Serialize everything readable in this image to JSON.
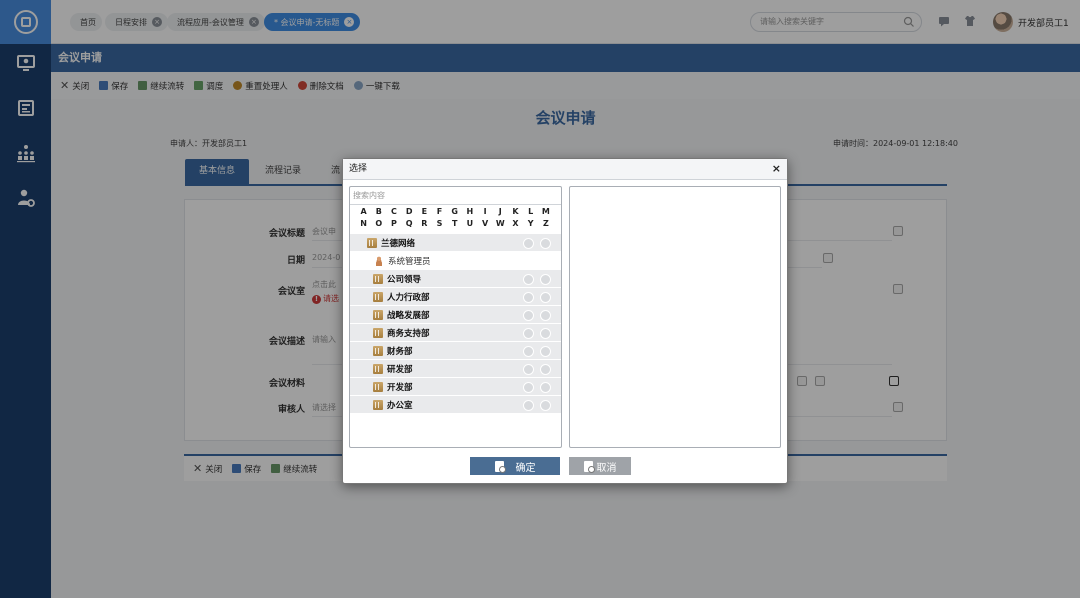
{
  "header": {
    "tabs": [
      {
        "label": "首页",
        "closable": false
      },
      {
        "label": "日程安排",
        "closable": true
      },
      {
        "label": "流程应用-会议管理",
        "closable": true
      },
      {
        "label": "* 会议申请-无标题",
        "closable": true,
        "active": true
      }
    ],
    "search_placeholder": "请输入搜索关键字",
    "username": "开发部员工1"
  },
  "sidebar": {
    "items": [
      {
        "icon": "app-logo-icon"
      },
      {
        "icon": "monitor-user-icon"
      },
      {
        "icon": "news-icon"
      },
      {
        "icon": "org-chart-icon"
      },
      {
        "icon": "user-settings-icon"
      }
    ]
  },
  "page": {
    "title": "会议申请",
    "toolbar": [
      "关闭",
      "保存",
      "继续流转",
      "调度",
      "重置处理人",
      "删除文档",
      "一键下载"
    ]
  },
  "form": {
    "title": "会议申请",
    "applicant": "申请人：开发部员工1",
    "apply_time": "申请时间：2024-09-01 12:18:40",
    "tabs": [
      "基本信息",
      "流程记录",
      "流"
    ],
    "fields": {
      "subject_label": "会议标题",
      "subject_value": "会议申",
      "date_label": "日期",
      "date_value": "2024-0",
      "room_label": "会议室",
      "room_value": "点击此",
      "room_error": "请选",
      "desc_label": "会议描述",
      "desc_value": "请输入",
      "material_label": "会议材料",
      "reviewer_label": "审核人",
      "reviewer_value": "请选择"
    },
    "bottom_toolbar": [
      "关闭",
      "保存",
      "继续流转"
    ]
  },
  "dialog": {
    "title": "选择",
    "close": "×",
    "search_placeholder": "搜索内容",
    "letters": [
      "A",
      "B",
      "C",
      "D",
      "E",
      "F",
      "G",
      "H",
      "I",
      "J",
      "K",
      "L",
      "M",
      "N",
      "O",
      "P",
      "Q",
      "R",
      "S",
      "T",
      "U",
      "V",
      "W",
      "X",
      "Y",
      "Z"
    ],
    "tree": [
      {
        "label": "兰德网络",
        "type": "org",
        "level": 0
      },
      {
        "label": "系统管理员",
        "type": "user",
        "level": 1
      },
      {
        "label": "公司领导",
        "type": "dept",
        "level": 1
      },
      {
        "label": "人力行政部",
        "type": "dept",
        "level": 1
      },
      {
        "label": "战略发展部",
        "type": "dept",
        "level": 1
      },
      {
        "label": "商务支持部",
        "type": "dept",
        "level": 1
      },
      {
        "label": "财务部",
        "type": "dept",
        "level": 1
      },
      {
        "label": "研发部",
        "type": "dept",
        "level": 1
      },
      {
        "label": "开发部",
        "type": "dept",
        "level": 1
      },
      {
        "label": "办公室",
        "type": "dept",
        "level": 1
      }
    ],
    "confirm_label": "确定",
    "cancel_label": "取消",
    "colors": {
      "confirm": "#4a6d93",
      "cancel": "#9fa3a8"
    }
  }
}
